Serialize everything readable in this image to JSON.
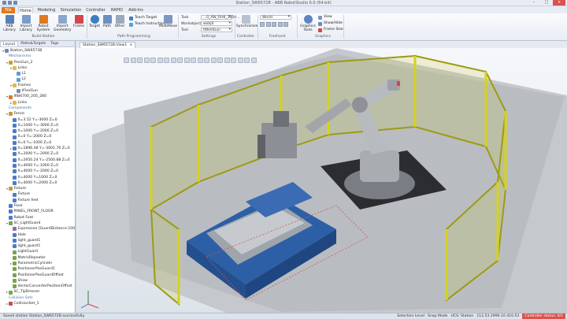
{
  "window": {
    "title": "Station_SW6572B - ABB RobotStudio 6.0 (64-bit)"
  },
  "tabs": [
    "File",
    "Home",
    "Modeling",
    "Simulation",
    "Controller",
    "RAPID",
    "Add-Ins"
  ],
  "ribbon": {
    "build_station": {
      "label": "Build Station",
      "buttons": [
        "ABB Library",
        "Import Library",
        "Robot System",
        "Import Geometry",
        "Frame"
      ]
    },
    "path_programming": {
      "label": "Path Programming",
      "buttons": [
        "Target",
        "Path",
        "Other",
        "MultiMove"
      ],
      "small": [
        "Teach Target",
        "Teach Instruction"
      ]
    },
    "settings": {
      "label": "Settings",
      "fields": [
        {
          "label": "Task",
          "value": "...0_AW_RHK_1050..."
        },
        {
          "label": "Workobject",
          "value": "wobj0"
        },
        {
          "label": "Tool",
          "value": "tWeldGun"
        }
      ]
    },
    "controller": {
      "label": "Controller",
      "buttons": [
        "Synchronize"
      ]
    },
    "freehand": {
      "label": "Freehand",
      "combo": "World"
    },
    "graphics": {
      "label": "Graphics",
      "buttons": [
        "Graphics Tools"
      ],
      "small": [
        "View",
        "Show/Hide",
        "Frame Size"
      ]
    }
  },
  "left_panel": {
    "tabs": [
      "Layout",
      "Paths&Targets",
      "Tags"
    ],
    "tree": [
      {
        "depth": 0,
        "label": "Station_SW6572B",
        "icon": "station",
        "open": true
      },
      {
        "depth": 1,
        "label": "Mechanisms",
        "cat": true
      },
      {
        "depth": 1,
        "label": "FlexGun_2",
        "icon": "mech",
        "open": true
      },
      {
        "depth": 2,
        "label": "Links",
        "icon": "folder",
        "open": true
      },
      {
        "depth": 3,
        "label": "L1",
        "icon": "link"
      },
      {
        "depth": 3,
        "label": "L2",
        "icon": "link"
      },
      {
        "depth": 2,
        "label": "Frames",
        "icon": "folder",
        "open": true
      },
      {
        "depth": 3,
        "label": "tFlexGun",
        "icon": "frame"
      },
      {
        "depth": 1,
        "label": "IRB6700_205_280",
        "icon": "robot",
        "open": true
      },
      {
        "depth": 2,
        "label": "Links",
        "icon": "folder",
        "closed": true
      },
      {
        "depth": 1,
        "label": "Components",
        "cat": true
      },
      {
        "depth": 1,
        "label": "Fence",
        "icon": "group",
        "open": true
      },
      {
        "depth": 2,
        "label": "X=3.52 Y=-3000 Z=0",
        "icon": "part"
      },
      {
        "depth": 2,
        "label": "X=1000 Y=-3000 Z=0",
        "icon": "part"
      },
      {
        "depth": 2,
        "label": "X=1000 Y=-2000 Z=0",
        "icon": "part"
      },
      {
        "depth": 2,
        "label": "X=0 Y=-2000 Z=0",
        "icon": "part"
      },
      {
        "depth": 2,
        "label": "X=0 Y=-1000 Z=0",
        "icon": "part"
      },
      {
        "depth": 2,
        "label": "X=1896.48 Y=-3001.76 Z=0",
        "icon": "part",
        "closed": true
      },
      {
        "depth": 2,
        "label": "X=2000 Y=-2000 Z=0",
        "icon": "part"
      },
      {
        "depth": 2,
        "label": "X=2950.24 Y=-2500.88 Z=0",
        "icon": "part"
      },
      {
        "depth": 2,
        "label": "X=4000 Y=-1000 Z=0",
        "icon": "part"
      },
      {
        "depth": 2,
        "label": "X=4000 Y=-2000 Z=0",
        "icon": "part"
      },
      {
        "depth": 2,
        "label": "X=4000 Y=1000 Z=0",
        "icon": "part"
      },
      {
        "depth": 2,
        "label": "X=4000 Y=2000 Z=0",
        "icon": "part"
      },
      {
        "depth": 1,
        "label": "Fixture",
        "icon": "group",
        "open": true
      },
      {
        "depth": 2,
        "label": "Fixture",
        "icon": "part"
      },
      {
        "depth": 2,
        "label": "Fixture feet",
        "icon": "part"
      },
      {
        "depth": 1,
        "label": "Floor",
        "icon": "part"
      },
      {
        "depth": 1,
        "label": "PANEL_FRONT_FLOOR",
        "icon": "part"
      },
      {
        "depth": 1,
        "label": "Robot Foot",
        "icon": "part"
      },
      {
        "depth": 1,
        "label": "SC_LightGuard",
        "icon": "smart",
        "open": true
      },
      {
        "depth": 2,
        "label": "Expression [GuardDistance:1000]",
        "icon": "expr"
      },
      {
        "depth": 2,
        "label": "Hole",
        "icon": "part"
      },
      {
        "depth": 2,
        "label": "light_guard1",
        "icon": "part"
      },
      {
        "depth": 2,
        "label": "light_guard1",
        "icon": "part"
      },
      {
        "depth": 2,
        "label": "LightGuard",
        "icon": "smart"
      },
      {
        "depth": 2,
        "label": "MatrixRepeater",
        "icon": "smart"
      },
      {
        "depth": 2,
        "label": "ParametricCylinder",
        "icon": "smart",
        "closed": true
      },
      {
        "depth": 2,
        "label": "PositionerPosGuard1",
        "icon": "smart"
      },
      {
        "depth": 2,
        "label": "PositionerPosGuardOffset",
        "icon": "smart"
      },
      {
        "depth": 2,
        "label": "Show",
        "icon": "smart"
      },
      {
        "depth": 2,
        "label": "VectorConverterPositionOffset",
        "icon": "smart"
      },
      {
        "depth": 1,
        "label": "SC_TipDresser",
        "icon": "smart",
        "closed": true
      },
      {
        "depth": 1,
        "label": "Collision Sets",
        "cat": true
      },
      {
        "depth": 1,
        "label": "CollisionSet_1",
        "icon": "collision",
        "closed": true
      }
    ]
  },
  "document": {
    "tab_label": "Station_SW6572B:View1",
    "close_glyph": "×"
  },
  "status": {
    "message": "Saved station Station_SW6572B successfully.",
    "selection_level": "Selection Level",
    "snap_mode": "Snap Mode",
    "ucs": "UCS: Station",
    "coords": "112.53  2990.10  410.52",
    "controller_status": "Controller status: 0/1"
  },
  "colors": {
    "file_tab": "#e07a1f",
    "fence_yellow": "#c9c51f",
    "fixture_blue": "#2d5fa6",
    "robot_grey": "#a9adb2",
    "status_red": "#d9534f"
  },
  "icons": {
    "station": "#6c89b6",
    "mech": "#d19b2e",
    "folder": "#e4b84a",
    "link": "#5aa0d8",
    "frame": "#7b8fa8",
    "robot": "#e07a1f",
    "group": "#c49a3a",
    "part": "#4d7cc7",
    "smart": "#7aa34d",
    "expr": "#8c6bb4",
    "collision": "#c94c4c"
  }
}
